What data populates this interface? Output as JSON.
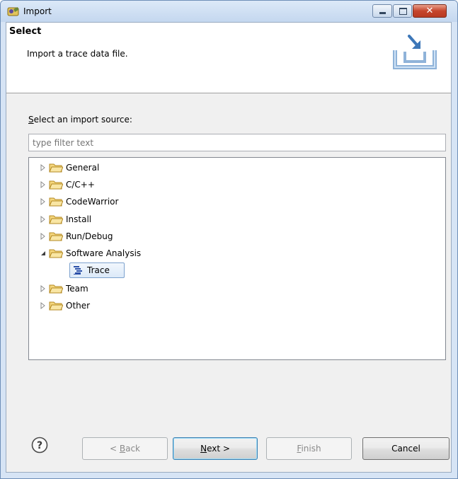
{
  "window": {
    "title": "Import"
  },
  "header": {
    "title": "Select",
    "description": "Import a trace data file."
  },
  "source": {
    "label_accel": "S",
    "label_rest": "elect an import source:",
    "filter_placeholder": "type filter text"
  },
  "tree": {
    "items": [
      {
        "label": "General",
        "expanded": false
      },
      {
        "label": "C/C++",
        "expanded": false
      },
      {
        "label": "CodeWarrior",
        "expanded": false
      },
      {
        "label": "Install",
        "expanded": false
      },
      {
        "label": "Run/Debug",
        "expanded": false
      },
      {
        "label": "Software Analysis",
        "expanded": true
      },
      {
        "label": "Trace",
        "selected": true,
        "child_of": "Software Analysis"
      },
      {
        "label": "Team",
        "expanded": false
      },
      {
        "label": "Other",
        "expanded": false
      }
    ]
  },
  "buttons": {
    "back": {
      "prefix": "< ",
      "accel": "B",
      "rest": "ack",
      "enabled": false
    },
    "next": {
      "accel": "N",
      "rest": "ext >",
      "enabled": true
    },
    "finish": {
      "accel": "F",
      "rest": "inish",
      "enabled": false
    },
    "cancel": {
      "label": "Cancel",
      "enabled": true
    }
  },
  "colors": {
    "title_bar": "#c4d7ef",
    "close_button": "#c6452c",
    "selection": "#dbe9f8",
    "folder": "#e8c25a"
  },
  "icons": {
    "title": "eclipse-import-icon",
    "header": "import-tray-icon",
    "help": "help-icon",
    "folder": "folder-icon",
    "trace": "trace-icon"
  }
}
